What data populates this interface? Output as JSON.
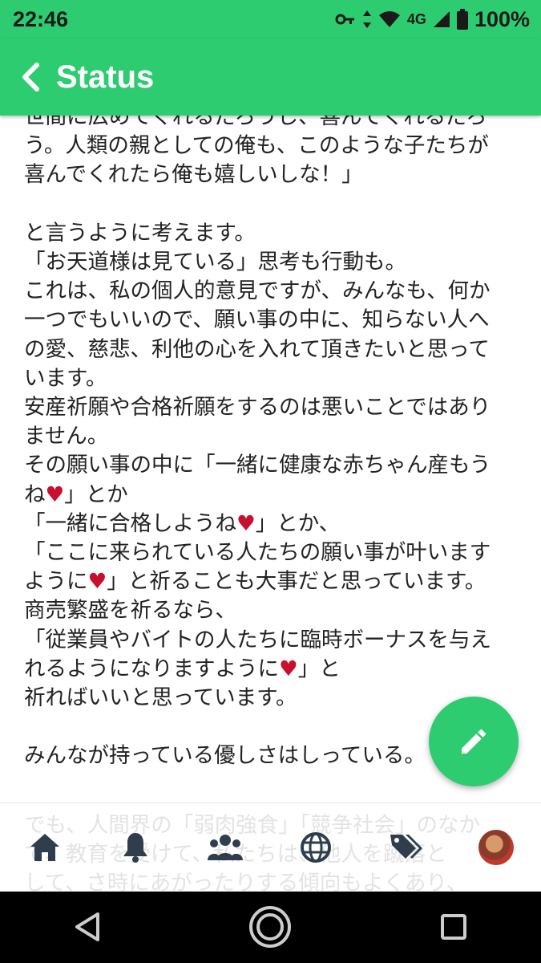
{
  "status_bar": {
    "time": "22:46",
    "network": "4G",
    "battery": "100%",
    "icons": [
      "key-icon",
      "data-arrows-icon",
      "wifi-icon",
      "signal-icon",
      "battery-icon"
    ]
  },
  "appbar": {
    "title": "Status",
    "back_icon": "chevron-left-icon"
  },
  "post": {
    "line_top_cut": "世間に広めてくれるだろうし、喜んでくれるだろ",
    "line1": "う。人類の親としての俺も、このような子たちが",
    "line2": "喜んでくれたら俺も嬉しいしな！」",
    "line3": "と言うように考えます。",
    "line4": "「お天道様は見ている」思考も行動も。",
    "line5": "これは、私の個人的意見ですが、みんなも、何か",
    "line6": "一つでもいいので、願い事の中に、知らない人へ",
    "line7": "の愛、慈悲、利他の心を入れて頂きたいと思って",
    "line8": "います。",
    "line9": "安産祈願や合格祈願をするのは悪いことではあり",
    "line10": "ません。",
    "line11": "その願い事の中に「一緒に健康な赤ちゃん産もう",
    "line12a": "ね",
    "line12b": "」とか",
    "line13a": "「一緒に合格しようね",
    "line13b": "」とか、",
    "line14": "「ここに来られている人たちの願い事が叶います",
    "line15a": "ように",
    "line15b": "」と祈ることも大事だと思っています。",
    "line16": "商売繁盛を祈るなら、",
    "line17": "「従業員やバイトの人たちに臨時ボーナスを与え",
    "line18a": "れるようになりますように",
    "line18b": "」と",
    "line19": "祈ればいいと思っています。",
    "line20": "みんなが持っている優しさはしっている。",
    "heart": "♥",
    "ghost1": "でも、人間界の「弱肉強食」「競争社会」のなか",
    "ghost2": "で、教育を受けて、私たちは、他人を蹴落と",
    "ghost3": "して、さ時にあがったりする傾向もよくあり、"
  },
  "fab": {
    "icon": "pencil-icon"
  },
  "bottom_nav": {
    "items": [
      "home-icon",
      "bell-icon",
      "people-icon",
      "globe-icon",
      "tags-icon",
      "avatar"
    ]
  },
  "system_nav": {
    "items": [
      "back-triangle-icon",
      "home-circle-icon",
      "recents-square-icon"
    ]
  },
  "colors": {
    "accent": "#2ecc71",
    "heart": "#c8102e"
  }
}
